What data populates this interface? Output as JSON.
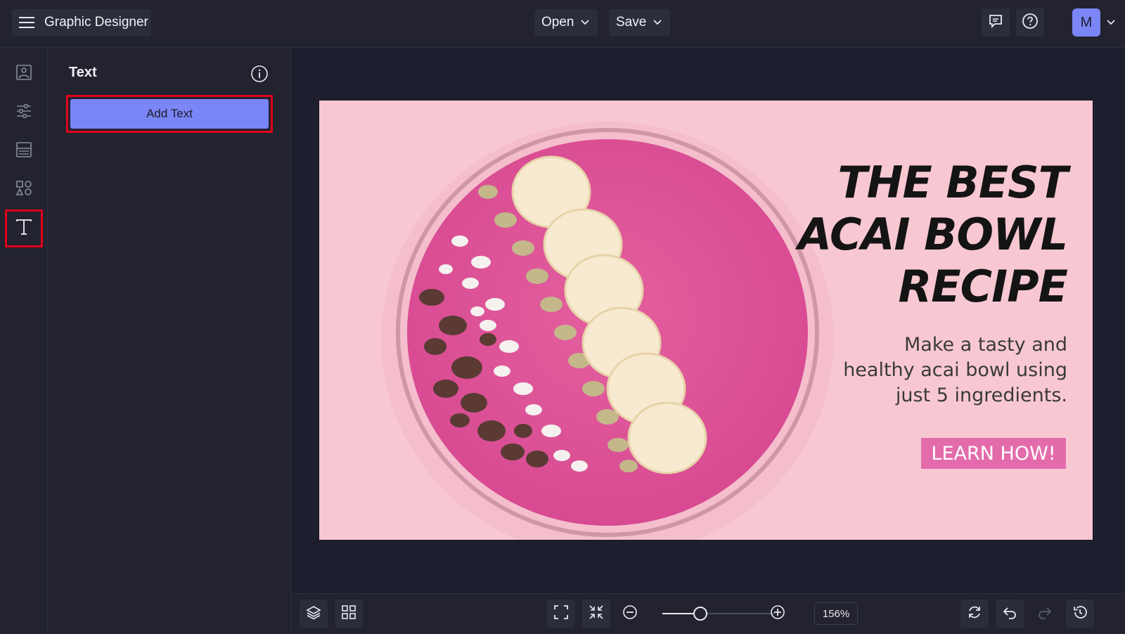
{
  "header": {
    "menu_icon": "hamburger-menu-icon",
    "app_title": "Graphic Designer",
    "open_label": "Open",
    "save_label": "Save",
    "feedback_icon": "feedback-icon",
    "help_icon": "help-icon",
    "avatar_initial": "M"
  },
  "rail": {
    "items": [
      {
        "name": "image",
        "icon": "image-icon"
      },
      {
        "name": "adjustments",
        "icon": "sliders-icon"
      },
      {
        "name": "layouts",
        "icon": "layout-icon"
      },
      {
        "name": "graphics",
        "icon": "shapes-icon"
      },
      {
        "name": "text",
        "icon": "text-icon",
        "active": true
      }
    ]
  },
  "panel": {
    "title": "Text",
    "add_text_label": "Add Text"
  },
  "artboard": {
    "headline": [
      "THE BEST",
      "ACAI BOWL",
      "RECIPE"
    ],
    "subtext": [
      "Make a tasty and",
      "healthy acai bowl using",
      "just 5 ingredients."
    ],
    "cta_label": "LEARN HOW!",
    "colors": {
      "background": "#f8c8d2",
      "cta": "#e36bab",
      "smoothie": "#e0529a"
    }
  },
  "bottombar": {
    "zoom_value": "156%",
    "zoom_level_fraction": 0.34
  }
}
